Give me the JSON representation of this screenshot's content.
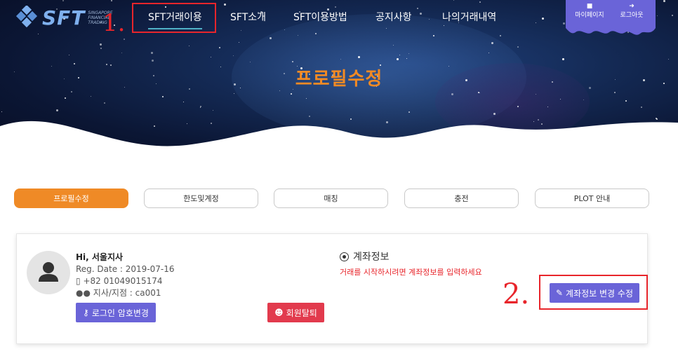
{
  "brand": {
    "name": "SFT",
    "sub_line1": "SINGAPORE",
    "sub_line2": "FINANCIAL",
    "sub_line3": "TRADING",
    "accent_color": "#ef8a26"
  },
  "nav": {
    "items": [
      {
        "label": "SFT거래이용",
        "active": true
      },
      {
        "label": "SFT소개"
      },
      {
        "label": "SFT이용방법"
      },
      {
        "label": "공지사항"
      },
      {
        "label": "나의거래내역"
      }
    ]
  },
  "user_menu": {
    "mypage_label": "마이페이지",
    "mypage_icon": "user-icon",
    "logout_label": "로그아웃",
    "logout_icon": "sign-out-icon"
  },
  "hero": {
    "title": "프로필수정"
  },
  "tabs": [
    {
      "label": "프로필수정",
      "active": true
    },
    {
      "label": "한도및계정"
    },
    {
      "label": "매칭"
    },
    {
      "label": "충전"
    },
    {
      "label": "PLOT 안내"
    }
  ],
  "profile": {
    "greeting": "Hi, 서울지사",
    "reg_date": "Reg. Date : 2019-07-16",
    "phone": "+82 01049015174",
    "branch": "지사/지점 : ca001",
    "password_button": "로그인 암호변경",
    "leave_button": "회원탈퇴"
  },
  "account": {
    "title": "계좌정보",
    "warning": "거래를 시작하시려면 계좌정보를 입력하세요",
    "edit_button": "계좌정보 변경 수정"
  },
  "annotations": {
    "step1": "1.",
    "step2": "2."
  }
}
